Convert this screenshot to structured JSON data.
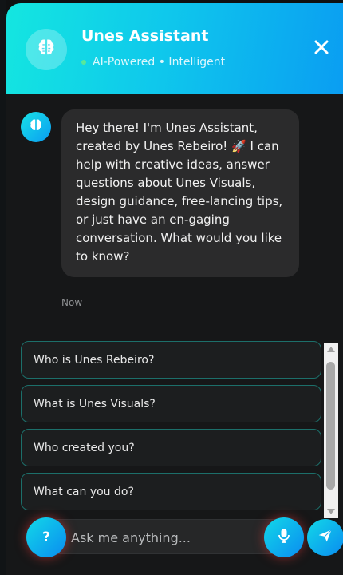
{
  "header": {
    "title": "Unes Assistant",
    "subtitle": "AI-Powered • Intelligent",
    "avatar_icon": "brain-icon",
    "close_icon": "close-icon"
  },
  "messages": [
    {
      "sender": "assistant",
      "text": "Hey there! I'm Unes Assistant, created by Unes Rebeiro! 🚀 I can help with creative ideas, answer questions about Unes Visuals, design guidance, free-lancing tips, or just have an en-gaging conversation. What would you like to know?",
      "time": "Now"
    }
  ],
  "quick_replies": [
    "Who is Unes Rebeiro?",
    "What is Unes Visuals?",
    "Who created you?",
    "What can you do?"
  ],
  "composer": {
    "placeholder": "Ask me anything...",
    "help_label": "?",
    "mic_icon": "microphone-icon",
    "send_icon": "send-icon"
  },
  "colors": {
    "accent_start": "#14e6e0",
    "accent_end": "#0a9cf2",
    "panel_bg": "#161718",
    "bubble_bg": "#2b2b2c",
    "quick_border": "#1c6f6a"
  }
}
